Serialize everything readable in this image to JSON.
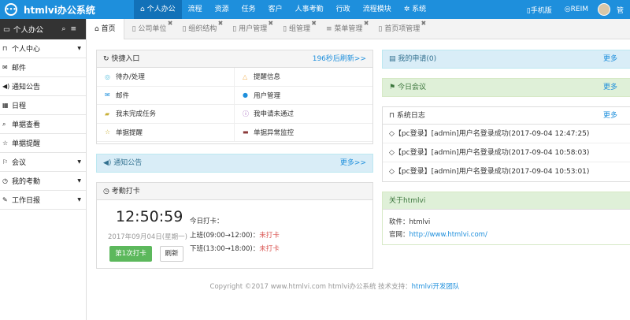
{
  "brand": {
    "logo_icon": "chat-bubble-icon",
    "name": "htmlvi办公系统"
  },
  "topnav": [
    {
      "label": "个人办公",
      "icon": "home-icon",
      "active": true
    },
    {
      "label": "流程"
    },
    {
      "label": "资源"
    },
    {
      "label": "任务"
    },
    {
      "label": "客户"
    },
    {
      "label": "人事考勤"
    },
    {
      "label": "行政"
    },
    {
      "label": "流程模块"
    },
    {
      "label": "系统",
      "icon": "gear-icon"
    }
  ],
  "topright": {
    "mobile": "手机版",
    "reim": "REIM",
    "user": "管"
  },
  "sidebar": {
    "title": "个人办公",
    "items": [
      {
        "label": "个人中心",
        "icon": "bookmark-icon",
        "caret": true
      },
      {
        "label": "邮件",
        "icon": "envelope-icon"
      },
      {
        "label": "通知公告",
        "icon": "volume-icon"
      },
      {
        "label": "日程",
        "icon": "calendar-icon"
      },
      {
        "label": "单据查看",
        "icon": "search-icon"
      },
      {
        "label": "单据提醒",
        "icon": "star-icon"
      },
      {
        "label": "会议",
        "icon": "flag-icon",
        "caret": true
      },
      {
        "label": "我的考勤",
        "icon": "clock-icon",
        "caret": true
      },
      {
        "label": "工作日报",
        "icon": "edit-icon",
        "caret": true
      }
    ]
  },
  "tabs": [
    {
      "label": "首页",
      "icon": "home-icon",
      "active": true
    },
    {
      "label": "公司单位"
    },
    {
      "label": "组织结构"
    },
    {
      "label": "用户管理"
    },
    {
      "label": "组管理"
    },
    {
      "label": "菜单管理"
    },
    {
      "label": "首页项管理"
    }
  ],
  "quick": {
    "title": "快捷入口",
    "refresh": "196秒后刷新>>",
    "items": [
      {
        "label": "待办/处理",
        "icon": "circle-icon",
        "color": "#5bc0de"
      },
      {
        "label": "提醒信息",
        "icon": "bell-icon",
        "color": "#f0ad4e"
      },
      {
        "label": "邮件",
        "icon": "envelope-icon",
        "color": "#1e8fdc"
      },
      {
        "label": "用户管理",
        "icon": "user-icon",
        "color": "#1e8fdc"
      },
      {
        "label": "我未完成任务",
        "icon": "book-icon",
        "color": "#c9b037"
      },
      {
        "label": "我申请未通过",
        "icon": "info-icon",
        "color": "#9b59b6"
      },
      {
        "label": "单据提醒",
        "icon": "star-icon",
        "color": "#c9b037"
      },
      {
        "label": "单据异常监控",
        "icon": "briefcase-icon",
        "color": "#8b3a3a"
      }
    ]
  },
  "notice": {
    "title": "通知公告",
    "more": "更多>>"
  },
  "attendance": {
    "title": "考勤打卡",
    "time": "12:50:59",
    "date": "2017年09月04日(星期一)",
    "today_label": "今日打卡：",
    "am_label": "上班(09:00→12:00)：",
    "am_status": "未打卡",
    "pm_label": "下班(13:00→18:00)：",
    "pm_status": "未打卡",
    "checkin_button": "第1次打卡",
    "refresh_button": "刷新"
  },
  "apply": {
    "title": "我的申请(0)",
    "more": "更多"
  },
  "meeting": {
    "title": "今日会议",
    "more": "更多"
  },
  "syslog": {
    "title": "系统日志",
    "more": "更多",
    "rows": [
      "◇【pc登录】[admin]用户名登录成功(2017-09-04 12:47:25)",
      "◇【pc登录】[admin]用户名登录成功(2017-09-04 10:58:03)",
      "◇【pc登录】[admin]用户名登录成功(2017-09-04 10:53:01)"
    ]
  },
  "about": {
    "title": "关于htmlvi",
    "software_label": "软件：",
    "software": "htmlvi",
    "site_label": "官网：",
    "site": "http://www.htmlvi.com/"
  },
  "footer": {
    "text": "Copyright ©2017  www.htmlvi.com  htmlvi办公系统  技术支持：",
    "support": "htmlvi开发团队"
  },
  "colors": {
    "primary": "#1e8fdc",
    "sidebar_head": "#333333",
    "success": "#5cb85c",
    "danger": "#d9534f"
  }
}
